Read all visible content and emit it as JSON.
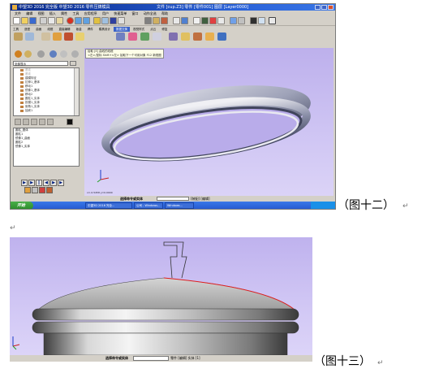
{
  "figure12": {
    "window_title": "中望3D 2016 完全版 中望3D 2016 零件压铸模具",
    "title_right": "文件 [cup.Z3] 零件 [零件001] 图层 [Layer0000]",
    "menu": [
      "文件",
      "编辑",
      "视图",
      "插入",
      "属性",
      "工具",
      "应用程序",
      "用户",
      "快速菜单",
      "窗口",
      "动作全选",
      "帮助"
    ],
    "tabs": [
      "工具",
      "造型",
      "曲面",
      "线框",
      "直接编辑",
      "钣金",
      "焊件",
      "模具设计",
      "数据交换",
      "视觉样式",
      "点云",
      "修复"
    ],
    "tree_combo": "全部显示",
    "tree_items": [
      "基准",
      "基准",
      "建模特征",
      "拉伸1_基体",
      "移动1",
      "镜像1_基体",
      "移动2",
      "圆柱1_实体",
      "拔模1_实体",
      "倒角1_实体",
      "抽壳1"
    ],
    "history_items": [
      "圆柱_基体",
      "圆柱1",
      "镜像1_曲面",
      "圆柱2",
      "镜像1_实体"
    ],
    "tooltip_line1": "拾取 [E] 曲线的线框",
    "tooltip_line2": "<左>/鼠标 Shift+<左> 拾取下一个可用对象 F12 新视图",
    "coord_text": "x=-0.5458 y=0.0000",
    "status_label": "选择命令或实体",
    "status_tail": "[装配] [编辑]",
    "taskbar": {
      "start": "开始",
      "tasks": [
        "中望3D 2016 完全...",
        "公司 - Windows...",
        "Windows..."
      ]
    }
  },
  "figure13": {
    "status_label": "选择命令或实体",
    "status_tail": "零件 [编辑] 实体 [1]"
  },
  "captions": {
    "fig12": "（图十二）",
    "fig13": "（图十三）"
  },
  "paragraph_mark": "↵"
}
